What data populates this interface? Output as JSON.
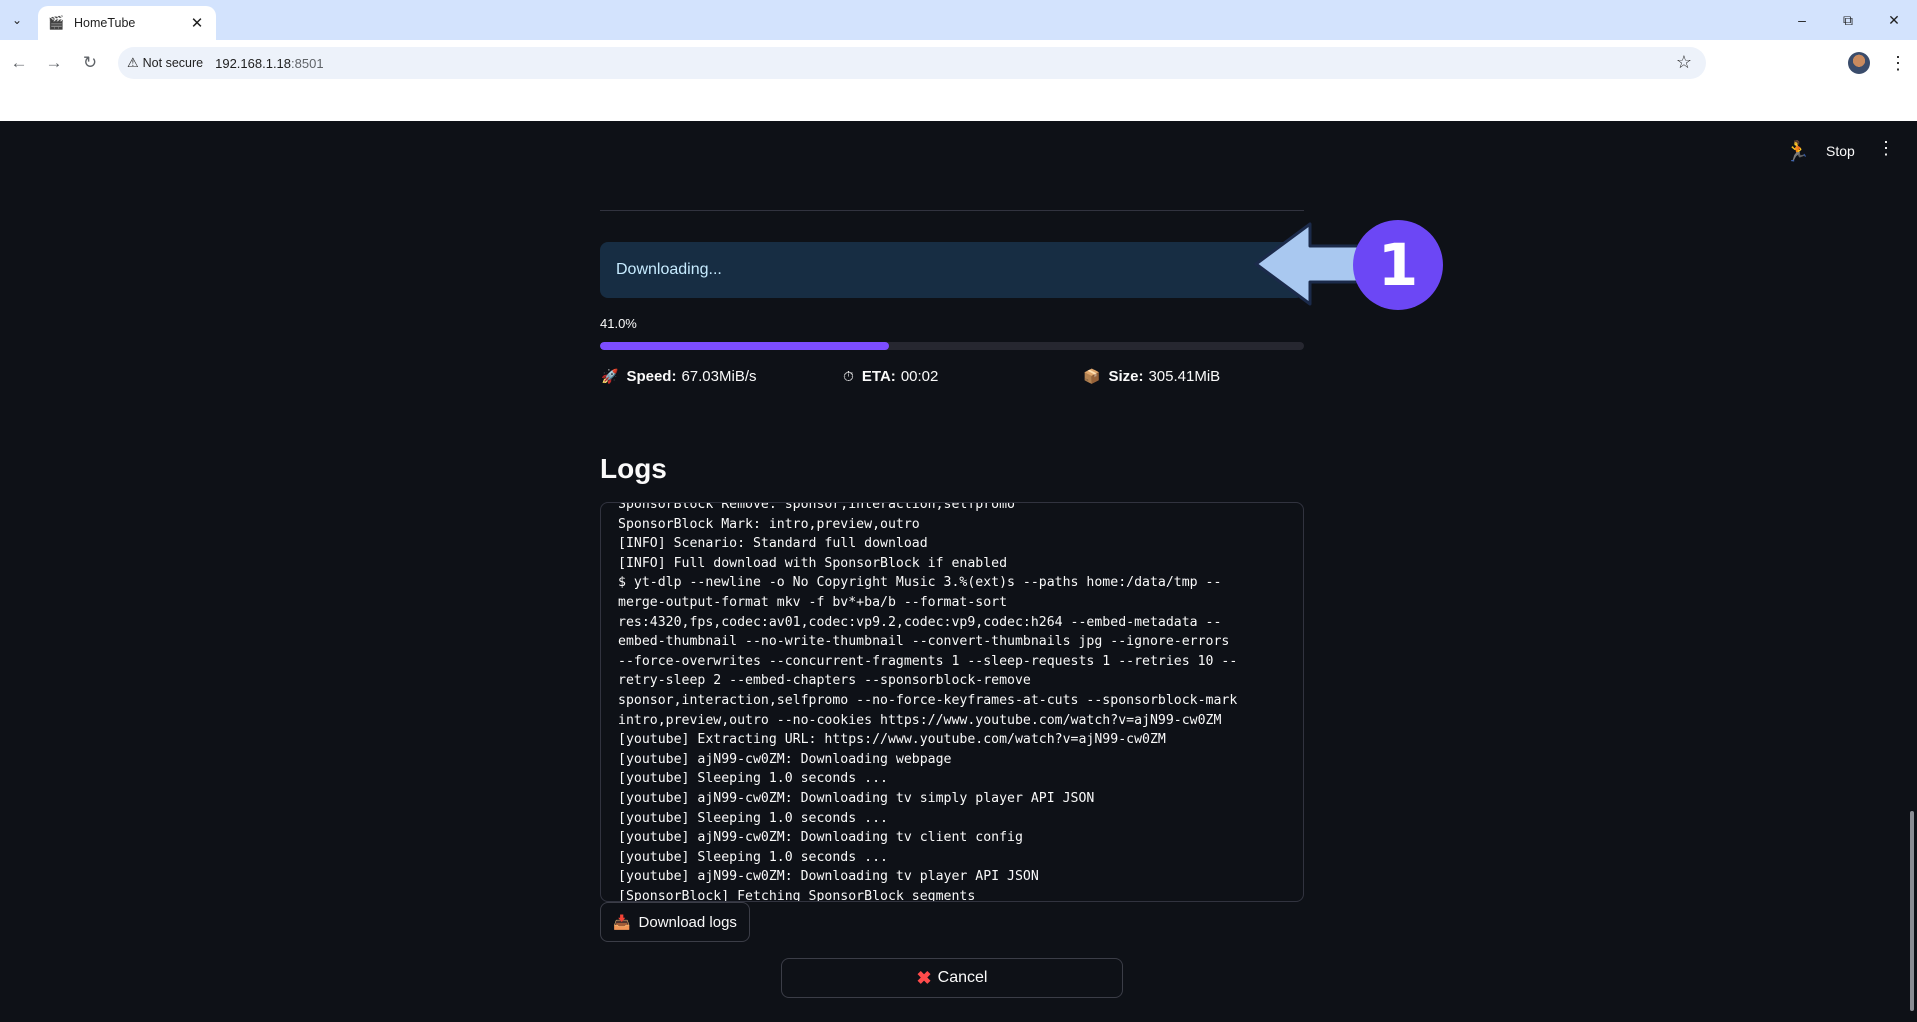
{
  "browser": {
    "tab_title": "HomeTube",
    "security_label": "Not secure",
    "url_host": "192.168.1.18",
    "url_port": ":8501"
  },
  "app_header": {
    "stop_label": "Stop"
  },
  "status": {
    "message": "Downloading..."
  },
  "progress": {
    "label": "41.0%",
    "fraction": 0.41
  },
  "stats": {
    "speed": {
      "label": "Speed:",
      "value": "67.03MiB/s",
      "icon": "rocket-icon"
    },
    "eta": {
      "label": "ETA:",
      "value": "00:02",
      "icon": "stopwatch-icon"
    },
    "size": {
      "label": "Size:",
      "value": "305.41MiB",
      "icon": "package-icon"
    }
  },
  "logs": {
    "heading": "Logs",
    "lines": [
      "SponsorBlock Remove: sponsor,interaction,selfpromo",
      "SponsorBlock Mark: intro,preview,outro",
      "[INFO] Scenario: Standard full download",
      "[INFO] Full download with SponsorBlock if enabled",
      "$ yt-dlp --newline -o No Copyright Music 3.%(ext)s --paths home:/data/tmp --",
      "merge-output-format mkv -f bv*+ba/b --format-sort",
      "res:4320,fps,codec:av01,codec:vp9.2,codec:vp9,codec:h264 --embed-metadata --",
      "embed-thumbnail --no-write-thumbnail --convert-thumbnails jpg --ignore-errors",
      "--force-overwrites --concurrent-fragments 1 --sleep-requests 1 --retries 10 --",
      "retry-sleep 2 --embed-chapters --sponsorblock-remove",
      "sponsor,interaction,selfpromo --no-force-keyframes-at-cuts --sponsorblock-mark",
      "intro,preview,outro --no-cookies https://www.youtube.com/watch?v=ajN99-cw0ZM",
      "[youtube] Extracting URL: https://www.youtube.com/watch?v=ajN99-cw0ZM",
      "[youtube] ajN99-cw0ZM: Downloading webpage",
      "[youtube] Sleeping 1.0 seconds ...",
      "[youtube] ajN99-cw0ZM: Downloading tv simply player API JSON",
      "[youtube] Sleeping 1.0 seconds ...",
      "[youtube] ajN99-cw0ZM: Downloading tv client config",
      "[youtube] Sleeping 1.0 seconds ...",
      "[youtube] ajN99-cw0ZM: Downloading tv player API JSON",
      "[SponsorBlock] Fetching SponsorBlock segments"
    ],
    "download_label": "Download logs"
  },
  "cancel_label": "Cancel",
  "annotation": {
    "number": "1",
    "color": "#6c47f5",
    "arrow_color": "#a9c8f0"
  }
}
